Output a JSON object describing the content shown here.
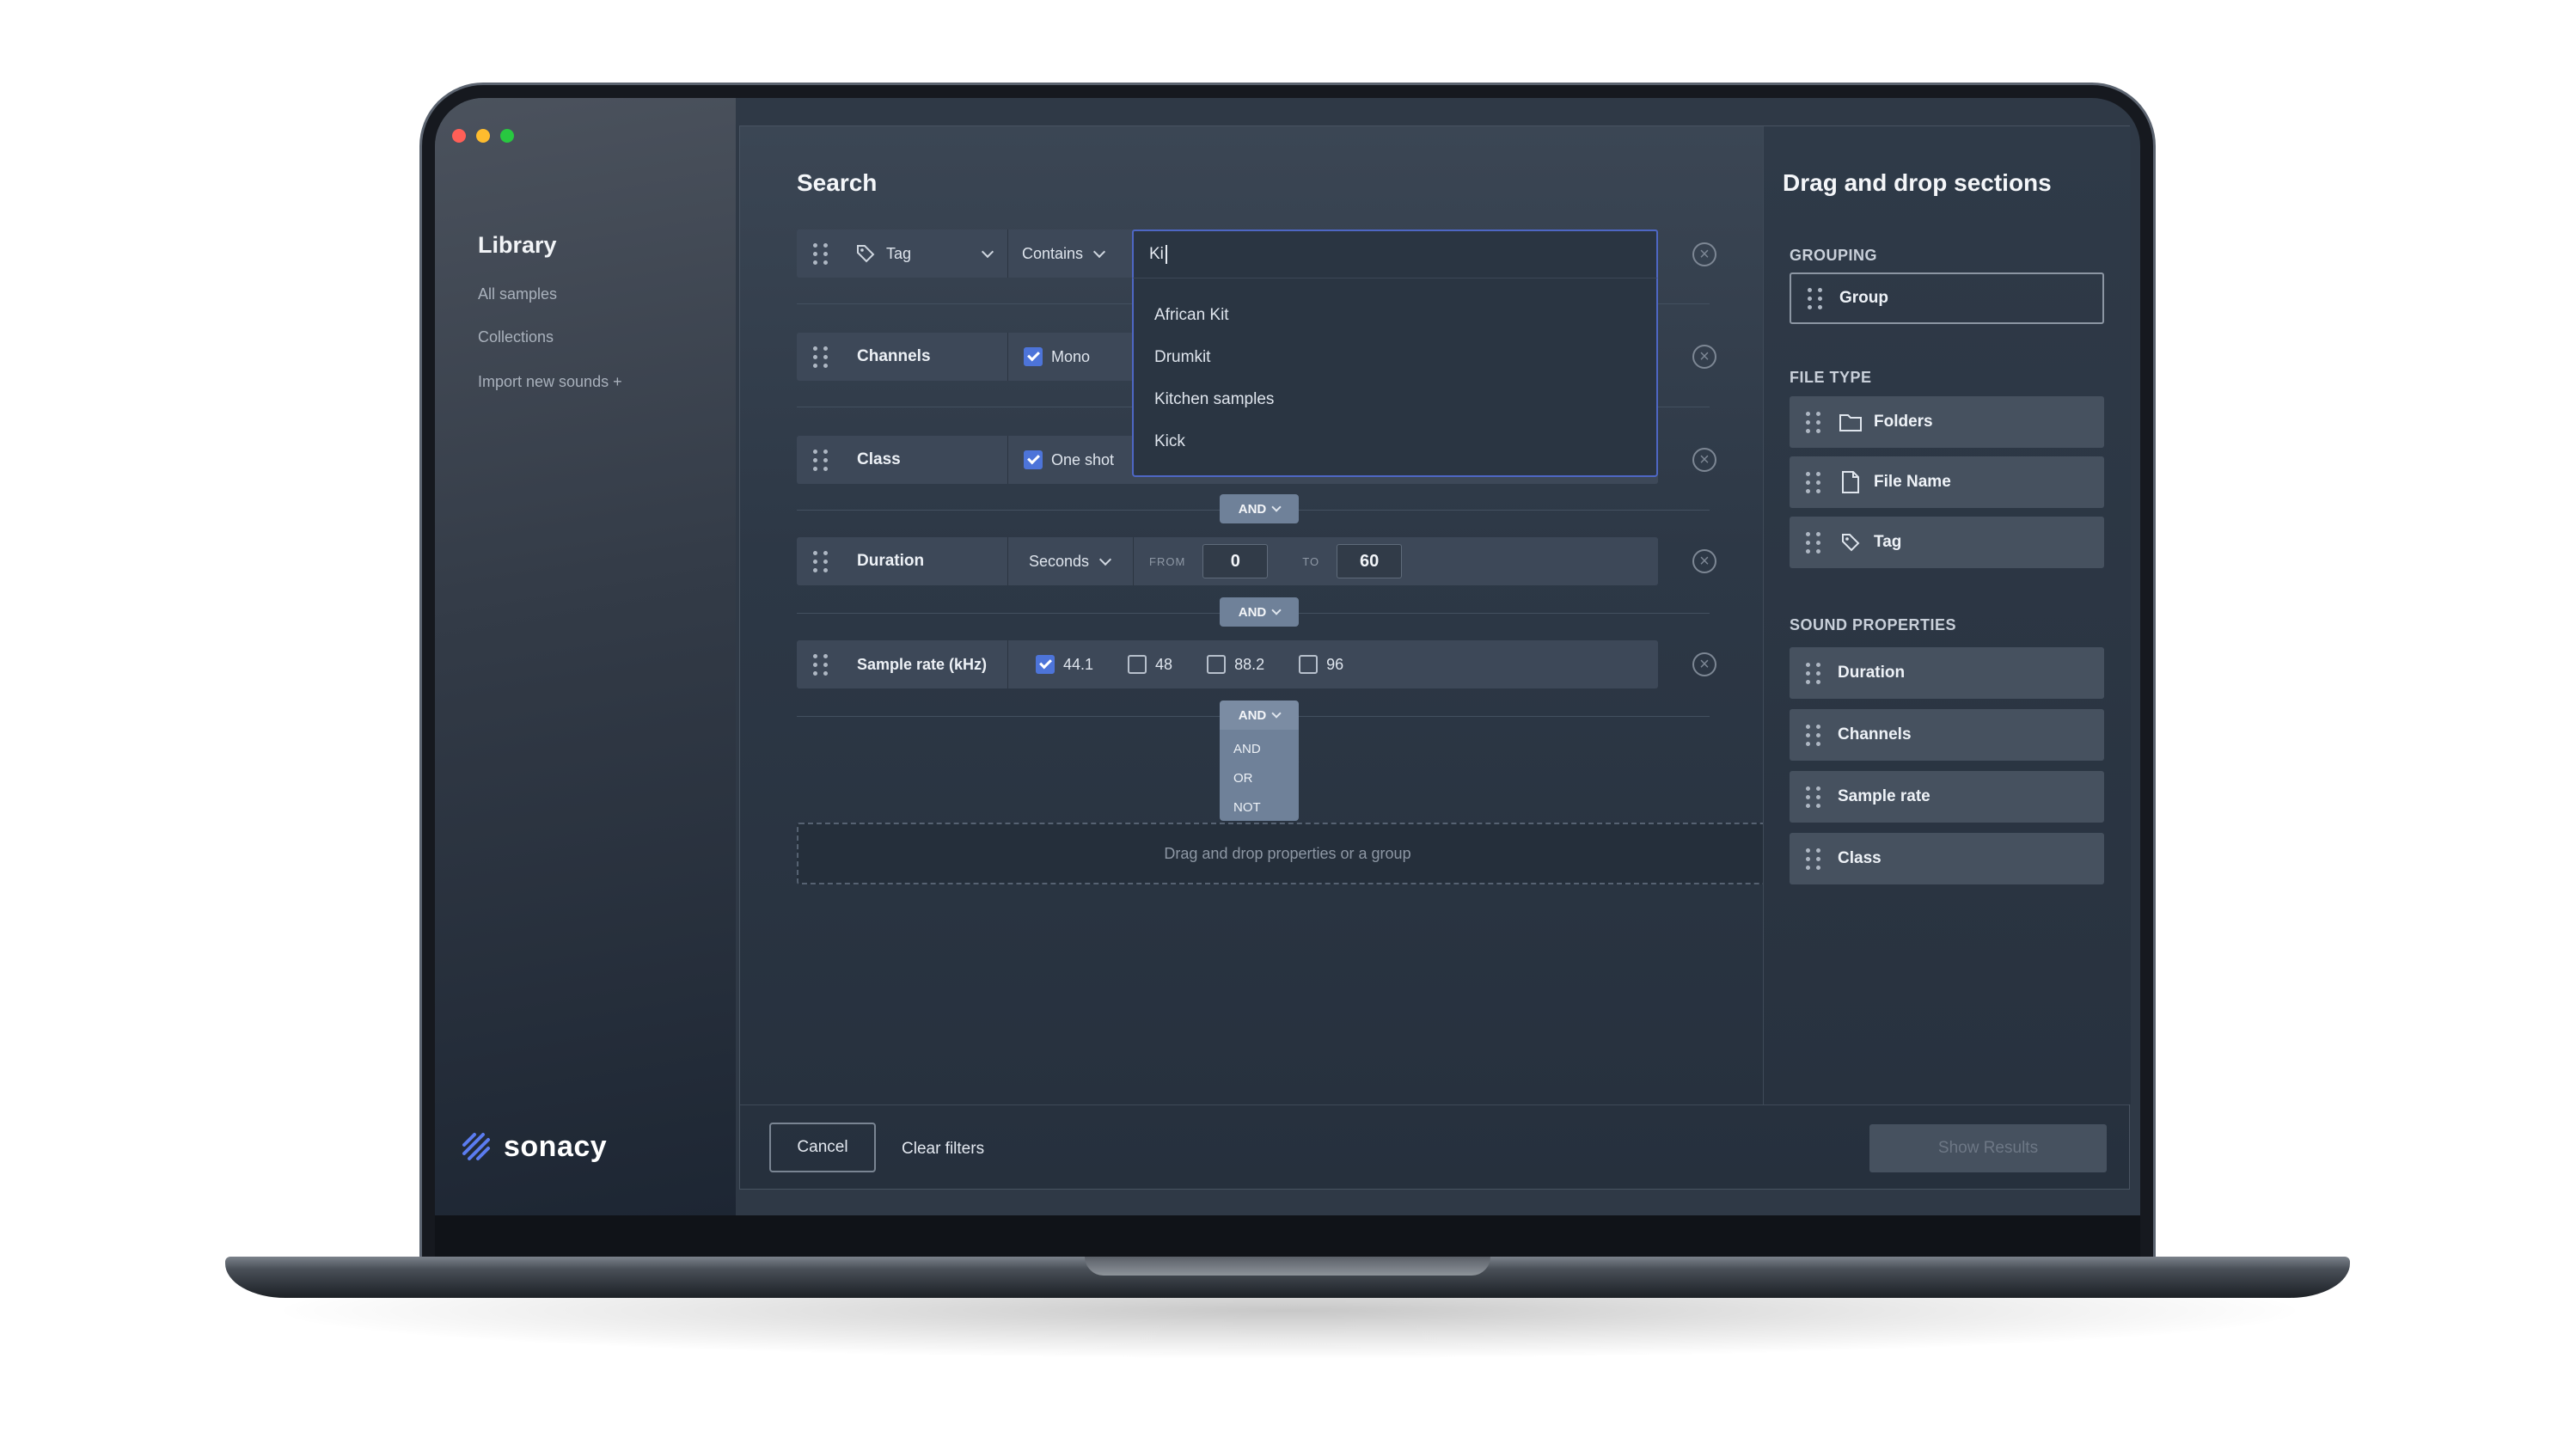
{
  "sidebar": {
    "title": "Library",
    "links": [
      "All samples",
      "Collections",
      "Import new sounds +"
    ],
    "brand": "sonacy"
  },
  "search": {
    "title": "Search",
    "rows": {
      "tag": {
        "field": "Tag",
        "operator": "Contains",
        "input_value": "Ki"
      },
      "channels": {
        "field": "Channels",
        "option": "Mono",
        "option_checked": true
      },
      "class": {
        "field": "Class",
        "option": "One shot",
        "option_checked": true
      },
      "duration": {
        "field": "Duration",
        "unit": "Seconds",
        "from_label": "FROM",
        "from_value": "0",
        "to_label": "TO",
        "to_value": "60"
      },
      "sample_rate": {
        "field": "Sample rate (kHz)",
        "options": [
          {
            "label": "44.1",
            "checked": true
          },
          {
            "label": "48",
            "checked": false
          },
          {
            "label": "88.2",
            "checked": false
          },
          {
            "label": "96",
            "checked": false
          }
        ]
      }
    },
    "suggestions": [
      "African Kit",
      "Drumkit",
      "Kitchen samples",
      "Kick"
    ],
    "connectors": [
      "AND",
      "AND",
      "AND"
    ],
    "operator_menu": [
      "AND",
      "OR",
      "NOT"
    ],
    "dropzone_text": "Drag and drop properties or a group"
  },
  "dnd": {
    "title": "Drag and drop sections",
    "grouping_label": "GROUPING",
    "grouping_items": [
      "Group"
    ],
    "file_type_label": "FILE TYPE",
    "file_type_items": [
      "Folders",
      "File Name",
      "Tag"
    ],
    "sound_label": "SOUND PROPERTIES",
    "sound_items": [
      "Duration",
      "Channels",
      "Sample rate",
      "Class"
    ]
  },
  "footer": {
    "cancel": "Cancel",
    "clear": "Clear filters",
    "show": "Show Results"
  },
  "colors": {
    "accent": "#4d74d9",
    "traffic_red": "#ff5f57",
    "traffic_yellow": "#febc2e",
    "traffic_green": "#28c840",
    "brand_mark": "#5b7cf0"
  }
}
